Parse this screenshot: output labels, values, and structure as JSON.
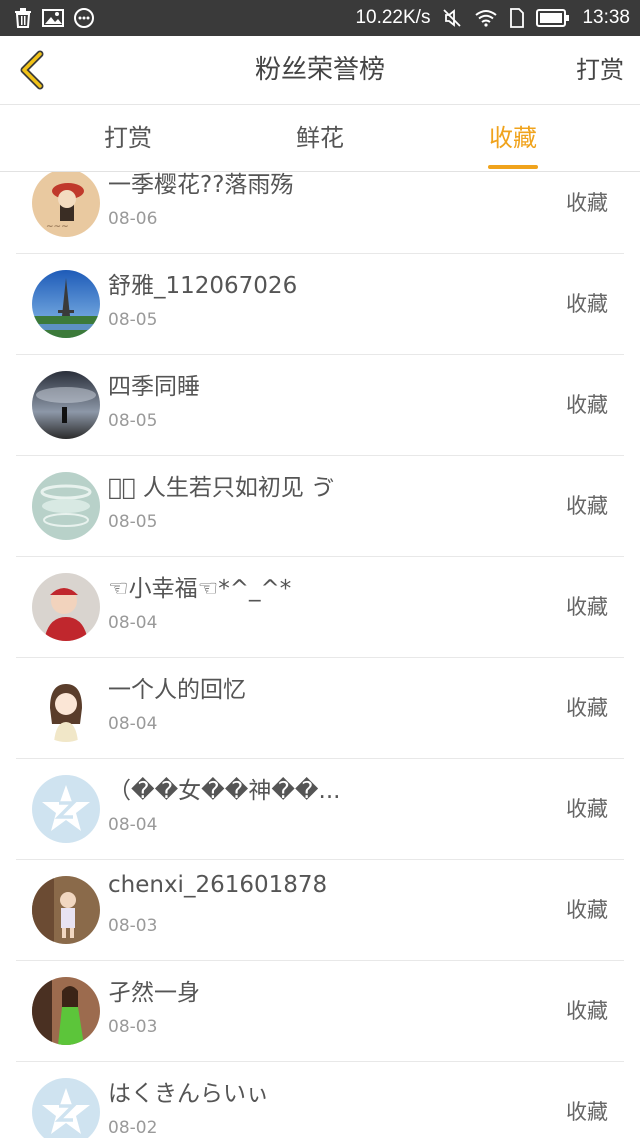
{
  "status_bar": {
    "speed": "10.22K/s",
    "time": "13:38"
  },
  "header": {
    "title": "粉丝荣誉榜",
    "action": "打赏"
  },
  "tabs": [
    {
      "label": "打赏"
    },
    {
      "label": "鲜花"
    },
    {
      "label": "收藏"
    }
  ],
  "active_tab": 2,
  "colors": {
    "accent": "#f0a31c",
    "status_bar": "#3a3a3a"
  },
  "entries": [
    {
      "name": "一季樱花??落雨殇",
      "date": "08-06",
      "action": "收藏",
      "avatar": "cartoon-avatar"
    },
    {
      "name": "舒雅_112067026",
      "date": "08-05",
      "action": "收藏",
      "avatar": "eiffel-tower-avatar"
    },
    {
      "name": "四季同睡",
      "date": "08-05",
      "action": "收藏",
      "avatar": "dusk-sky-avatar"
    },
    {
      "name": "ঞ゙ 人生若只如初见 ゔ",
      "date": "08-05",
      "action": "收藏",
      "avatar": "glass-avatar"
    },
    {
      "name": "☜小幸福☜*^_^*",
      "date": "08-04",
      "action": "收藏",
      "avatar": "baby-avatar"
    },
    {
      "name": "一个人的回忆",
      "date": "08-04",
      "action": "收藏",
      "avatar": "anime-girl-avatar"
    },
    {
      "name": "（��女��神��...",
      "date": "08-04",
      "action": "收藏",
      "avatar": "default-z-avatar"
    },
    {
      "name": "chenxi_261601878",
      "date": "08-03",
      "action": "收藏",
      "avatar": "child-photo-avatar"
    },
    {
      "name": "孑然一身",
      "date": "08-03",
      "action": "收藏",
      "avatar": "green-dress-avatar"
    },
    {
      "name": "はくきんらいぃ",
      "date": "08-02",
      "action": "收藏",
      "avatar": "default-z-avatar"
    }
  ]
}
